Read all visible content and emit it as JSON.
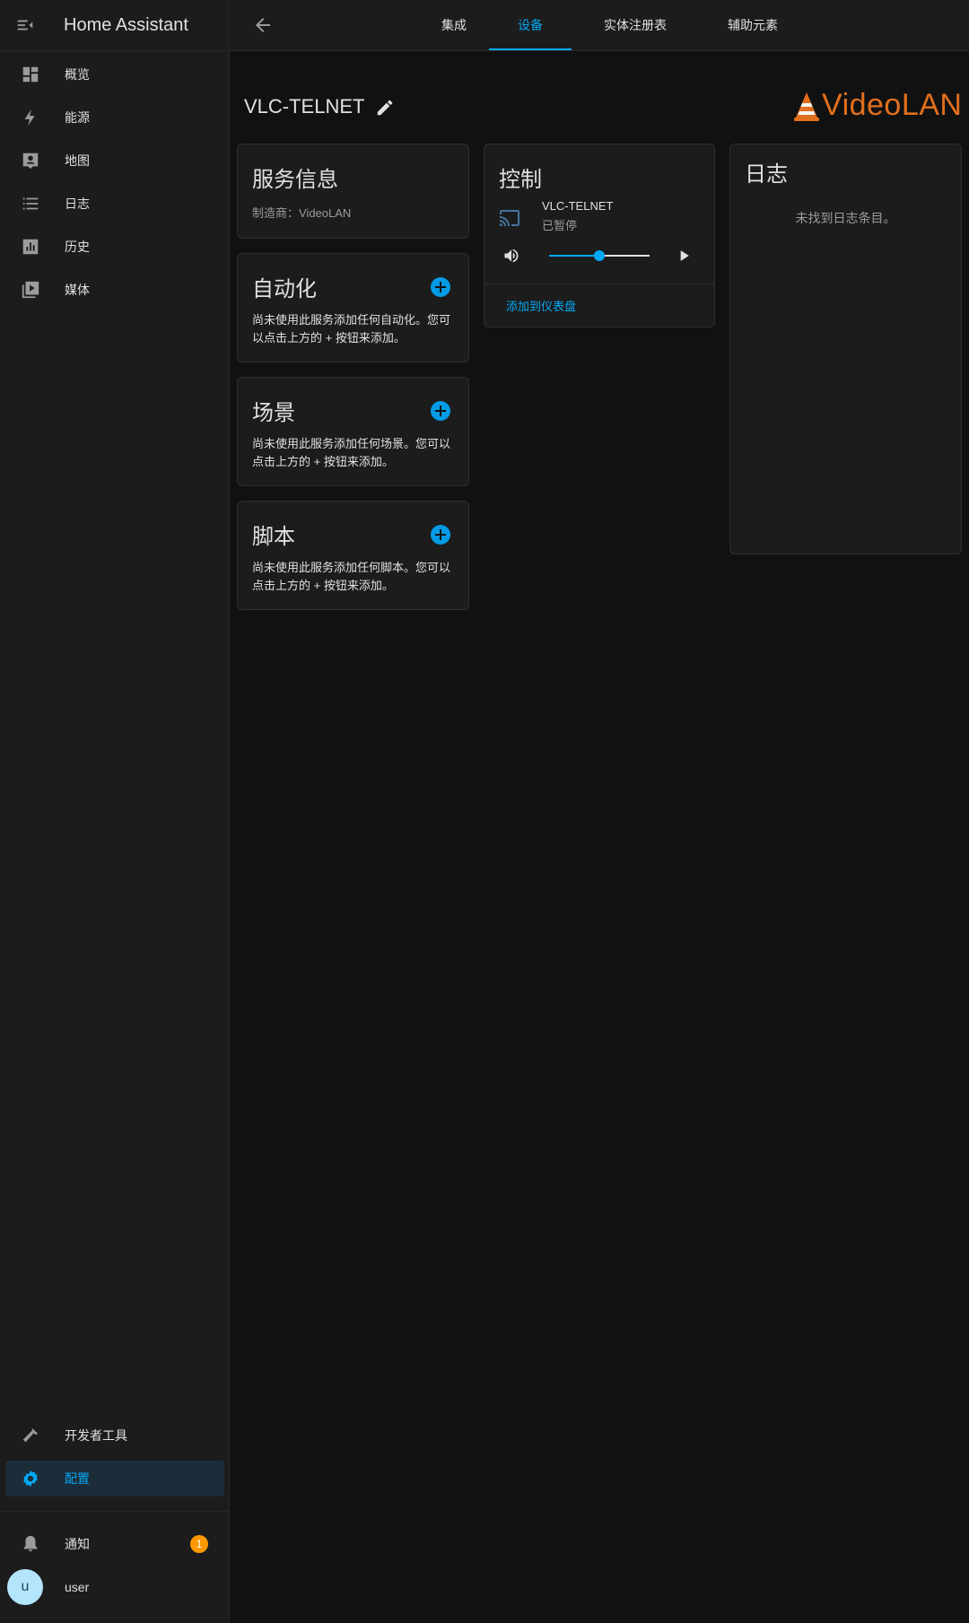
{
  "app": {
    "title": "Home Assistant"
  },
  "sidebar": {
    "items": [
      {
        "label": "概览",
        "icon": "dashboard-icon"
      },
      {
        "label": "能源",
        "icon": "lightning-icon"
      },
      {
        "label": "地图",
        "icon": "map-account-icon"
      },
      {
        "label": "日志",
        "icon": "format-list-icon"
      },
      {
        "label": "历史",
        "icon": "chart-box-icon"
      },
      {
        "label": "媒体",
        "icon": "play-box-multiple-icon"
      }
    ],
    "bottom_items": [
      {
        "label": "开发者工具",
        "icon": "hammer-icon"
      },
      {
        "label": "配置",
        "icon": "cog-icon",
        "active": true
      }
    ],
    "notifications": {
      "label": "通知",
      "count": "1"
    },
    "user": {
      "initial": "u",
      "name": "user"
    }
  },
  "tabs": [
    {
      "label": "集成"
    },
    {
      "label": "设备",
      "active": true
    },
    {
      "label": "实体注册表"
    },
    {
      "label": "辅助元素"
    }
  ],
  "device": {
    "name": "VLC-TELNET",
    "brand": "VideoLAN"
  },
  "cards": {
    "service_info": {
      "title": "服务信息",
      "manufacturer": "制造商：VideoLAN"
    },
    "automation": {
      "title": "自动化",
      "text": "尚未使用此服务添加任何自动化。您可以点击上方的 + 按钮来添加。"
    },
    "scene": {
      "title": "场景",
      "text": "尚未使用此服务添加任何场景。您可以点击上方的 + 按钮来添加。"
    },
    "script": {
      "title": "脚本",
      "text": "尚未使用此服务添加任何脚本。您可以点击上方的 + 按钮来添加。"
    },
    "control": {
      "title": "控制",
      "entity_name": "VLC-TELNET",
      "state": "已暂停",
      "volume_level": 0.5,
      "add_to_dashboard": "添加到仪表盘"
    },
    "logbook": {
      "title": "日志",
      "empty": "未找到日志条目。"
    }
  },
  "colors": {
    "accent": "#03a9f4",
    "brand": "#e26f1d",
    "badge": "#ff9800"
  }
}
